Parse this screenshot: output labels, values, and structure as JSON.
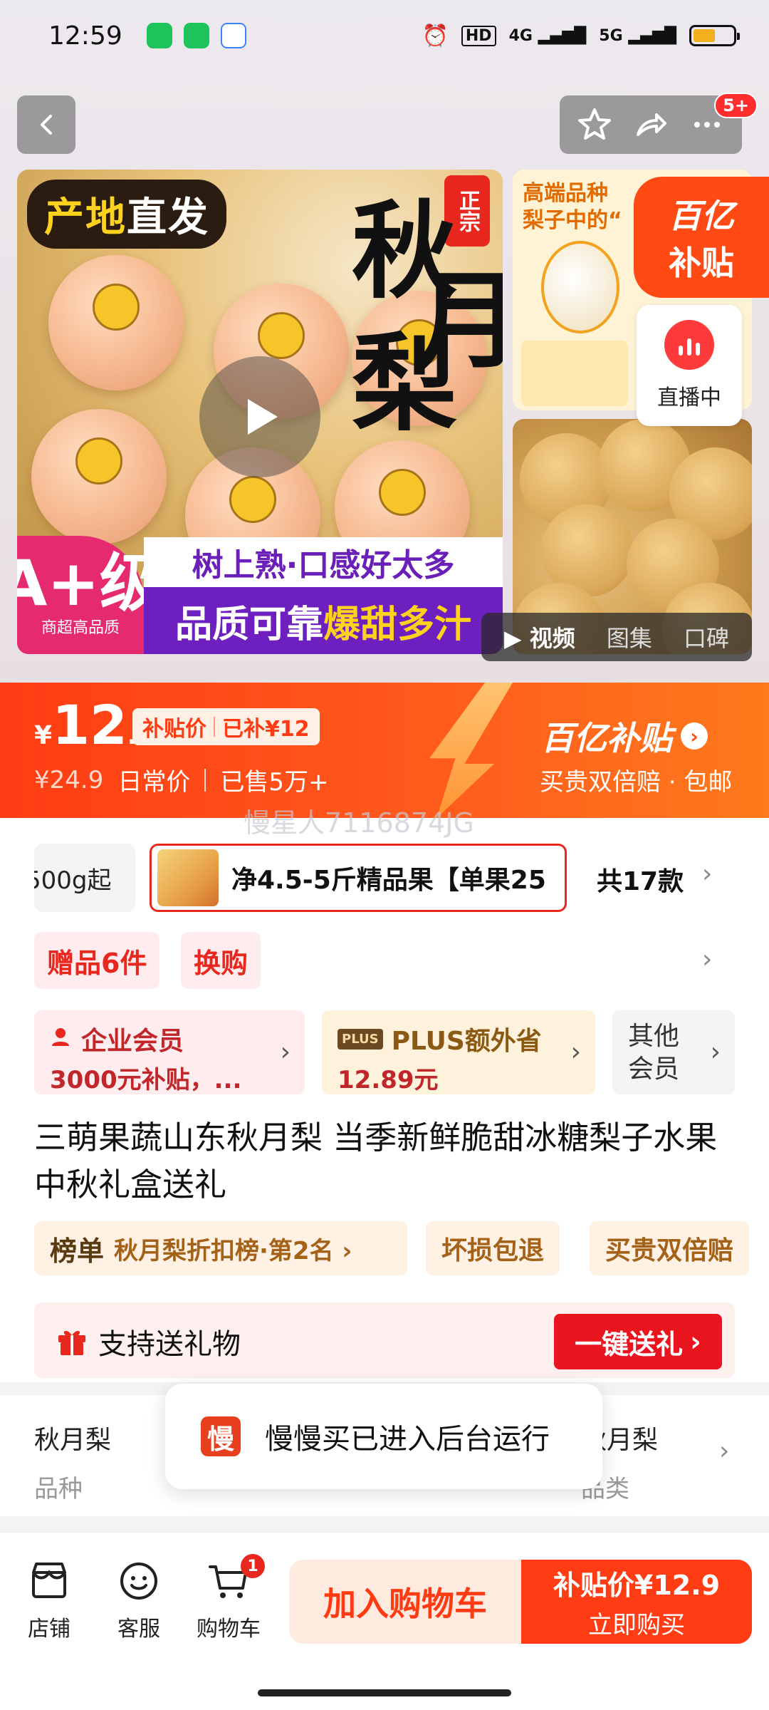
{
  "status_bar": {
    "time": "12:59",
    "hd": "HD",
    "net1": "4G",
    "net2": "5G"
  },
  "nav": {
    "badge": "5+"
  },
  "hero": {
    "origin_label_a": "产地",
    "origin_label_b": "直发",
    "zhengzong": "正宗",
    "big_char_1": "秋",
    "big_char_2": "月",
    "big_char_3": "梨",
    "grade_main": "A+级",
    "grade_sub": "商超高品质",
    "banner_line1": "树上熟·口感好太多",
    "banner_line2_a": "品质可靠",
    "banner_line2_b": "爆甜多汁",
    "side_title_1": "高端品种",
    "side_title_2": "梨子中的“",
    "yi_badge_top": "百亿",
    "yi_badge_bot": "补贴",
    "live_label": "直播中",
    "media_tabs": [
      "视频",
      "图集",
      "口碑"
    ]
  },
  "price": {
    "yen": "¥",
    "int": "12",
    "dec": ".9",
    "subsidy_label": "补贴价",
    "subsidy_amount": "已补¥12",
    "original": "¥24.9",
    "original_label": "日常价",
    "sold": "已售5万+",
    "yi_logo": "百亿补贴",
    "yi_sub": "买贵双倍赔 · 包邮"
  },
  "watermark": "慢星人7116874JG",
  "spec": {
    "prev": "500g起",
    "selected": "净4.5-5斤精品果【单果25",
    "count": "共17款"
  },
  "gifts": [
    "赠品6件",
    "换购"
  ],
  "members": {
    "enterprise_l1": "企业会员",
    "enterprise_l2": "3000元补贴，...",
    "plus_logo": "PLUS",
    "plus_l1": "PLUS额外省",
    "plus_l2": "12.89元",
    "other_l1": "其他",
    "other_l2": "会员"
  },
  "title": "三萌果蔬山东秋月梨 当季新鲜脆甜冰糖梨子水果中秋礼盒送礼",
  "rank": {
    "label": "榜单",
    "value": "秋月梨折扣榜·第2名 ›"
  },
  "services": [
    "坏损包退",
    "买贵双倍赔"
  ],
  "gift_box": {
    "label": "支持送礼物",
    "button": "一键送礼"
  },
  "attributes": [
    {
      "value": "秋月梨",
      "key": "品种"
    },
    {
      "value": "秋月梨",
      "key": "品类"
    }
  ],
  "toast": {
    "icon": "慢",
    "text": "慢慢买已进入后台运行"
  },
  "bottom": {
    "shop": "店铺",
    "service": "客服",
    "cart": "购物车",
    "cart_count": "1",
    "add_cart": "加入购物车",
    "buy_price": "补贴价¥12.9",
    "buy_label": "立即购买"
  }
}
